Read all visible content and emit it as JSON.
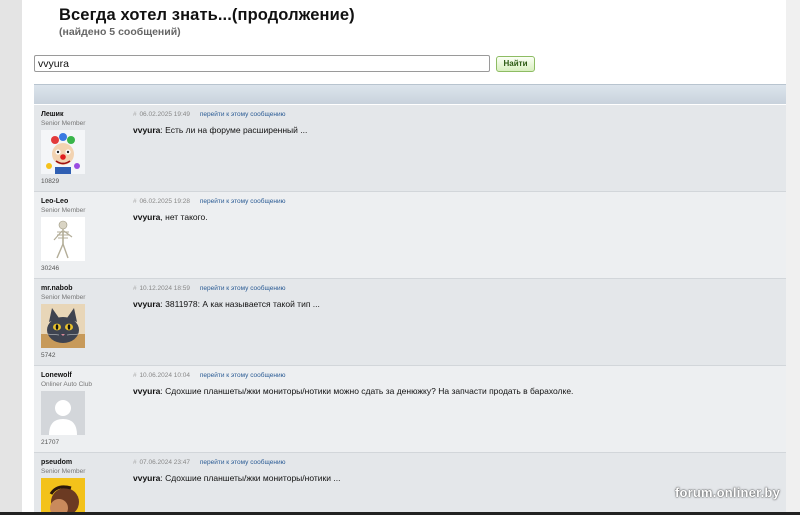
{
  "page": {
    "title": "Всегда хотел знать...(продолжение)",
    "subtitle": "(найдено 5 сообщений)"
  },
  "search": {
    "value": "vvyura",
    "button_label": "Найти"
  },
  "posts": [
    {
      "author": "Лешик",
      "rank": "Senior Member",
      "count": "10829",
      "avatar_icon": "clown-avatar-icon",
      "hash": "#",
      "date": "06.02.2025 19:49",
      "goto_label": "перейти к этому сообщению",
      "quote_author": "vvyura",
      "text": ": Есть ли на форуме расширенный ..."
    },
    {
      "author": "Leo-Leo",
      "rank": "Senior Member",
      "count": "30246",
      "avatar_icon": "skeleton-avatar-icon",
      "hash": "#",
      "date": "06.02.2025 19:28",
      "goto_label": "перейти к этому сообщению",
      "quote_author": "vvyura",
      "text": ", нет такого."
    },
    {
      "author": "mr.nabob",
      "rank": "Senior Member",
      "count": "5742",
      "avatar_icon": "cat-avatar-icon",
      "hash": "#",
      "date": "10.12.2024 18:59",
      "goto_label": "перейти к этому сообщению",
      "quote_author": "vvyura",
      "text": ": 3811978: А как называется такой тип ..."
    },
    {
      "author": "Lonewolf",
      "rank": "Onliner Auto Club",
      "count": "21707",
      "avatar_icon": "default-user-avatar-icon",
      "hash": "#",
      "date": "10.06.2024 10:04",
      "goto_label": "перейти к этому сообщению",
      "quote_author": "vvyura",
      "text": ": Сдохшие планшеты/жки мониторы/нотики можно сдать за денюжку? На запчасти продать в барахолке."
    },
    {
      "author": "pseudom",
      "rank": "Senior Member",
      "count": "",
      "avatar_icon": "child-avatar-icon",
      "hash": "#",
      "date": "07.06.2024 23:47",
      "goto_label": "перейти к этому сообщению",
      "quote_author": "vvyura",
      "text": ": Сдохшие планшеты/жки мониторы/нотики ..."
    }
  ],
  "watermark": "forum.onliner.by",
  "colors": {
    "row_odd": "#e4e7ea",
    "row_even": "#edeff1",
    "link": "#2a5b94",
    "button_border": "#8dbc63"
  }
}
